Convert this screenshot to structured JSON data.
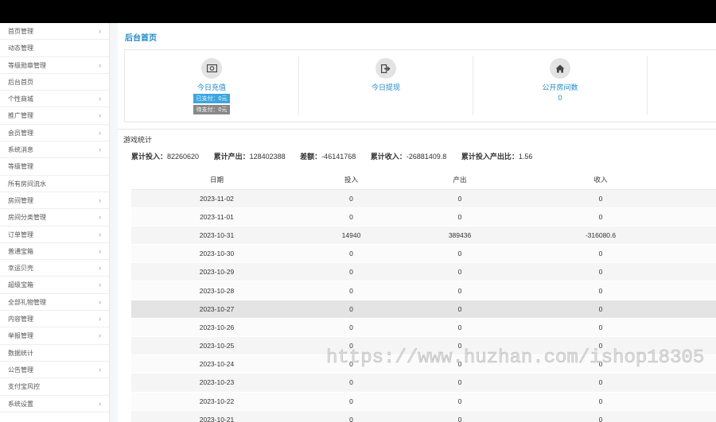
{
  "sidebar": {
    "items": [
      {
        "label": "首页管理",
        "chevron": true
      },
      {
        "label": "动态管理",
        "chevron": false
      },
      {
        "label": "等级勋章管理",
        "chevron": true
      },
      {
        "label": "后台首页",
        "chevron": false
      },
      {
        "label": "个性商城",
        "chevron": true
      },
      {
        "label": "推广管理",
        "chevron": true
      },
      {
        "label": "会员管理",
        "chevron": true
      },
      {
        "label": "系统消息",
        "chevron": true
      },
      {
        "label": "等级管理",
        "chevron": false
      },
      {
        "label": "所有房间流水",
        "chevron": false
      },
      {
        "label": "房间管理",
        "chevron": true
      },
      {
        "label": "房间分类管理",
        "chevron": true
      },
      {
        "label": "订单管理",
        "chevron": true
      },
      {
        "label": "普通宝箱",
        "chevron": true
      },
      {
        "label": "幸运贝壳",
        "chevron": true
      },
      {
        "label": "超级宝箱",
        "chevron": true
      },
      {
        "label": "全部礼物管理",
        "chevron": true
      },
      {
        "label": "内容管理",
        "chevron": true
      },
      {
        "label": "举报管理",
        "chevron": true
      },
      {
        "label": "数据统计",
        "chevron": false
      },
      {
        "label": "公告管理",
        "chevron": true
      },
      {
        "label": "支付宝风控",
        "chevron": false
      },
      {
        "label": "系统设置",
        "chevron": true
      }
    ]
  },
  "page": {
    "title": "后台首页"
  },
  "stats": {
    "recharge": {
      "icon": "money-icon",
      "label": "今日充值",
      "paid": "已支付：0元",
      "unpaid": "待支付：0元"
    },
    "withdraw": {
      "icon": "sign-out-icon",
      "label": "今日提现"
    },
    "rooms": {
      "icon": "home-icon",
      "label": "公开房间数",
      "value": "0"
    }
  },
  "game": {
    "section_title": "游戏统计",
    "summary": {
      "invest_label": "累计投入：",
      "invest_value": "82260620",
      "output_label": "累计产出：",
      "output_value": "128402388",
      "diff_label": "差额：",
      "diff_value": "-46141768",
      "income_label": "累计收入：",
      "income_value": "-26881409.8",
      "ratio_label": "累计投入产出比：",
      "ratio_value": "1.56"
    },
    "columns": [
      "日期",
      "投入",
      "产出",
      "收入"
    ],
    "rows": [
      [
        "2023-11-02",
        "0",
        "0",
        "0"
      ],
      [
        "2023-11-01",
        "0",
        "0",
        "0"
      ],
      [
        "2023-10-31",
        "14940",
        "389436",
        "-316080.6"
      ],
      [
        "2023-10-30",
        "0",
        "0",
        "0"
      ],
      [
        "2023-10-29",
        "0",
        "0",
        "0"
      ],
      [
        "2023-10-28",
        "0",
        "0",
        "0"
      ],
      [
        "2023-10-27",
        "0",
        "0",
        "0"
      ],
      [
        "2023-10-26",
        "0",
        "0",
        "0"
      ],
      [
        "2023-10-25",
        "0",
        "0",
        "0"
      ],
      [
        "2023-10-24",
        "0",
        "0",
        "0"
      ],
      [
        "2023-10-23",
        "0",
        "0",
        "0"
      ],
      [
        "2023-10-22",
        "0",
        "0",
        "0"
      ],
      [
        "2023-10-21",
        "0",
        "0",
        "0"
      ]
    ]
  },
  "watermark": "https://www.huzhan.com/ishop18305"
}
